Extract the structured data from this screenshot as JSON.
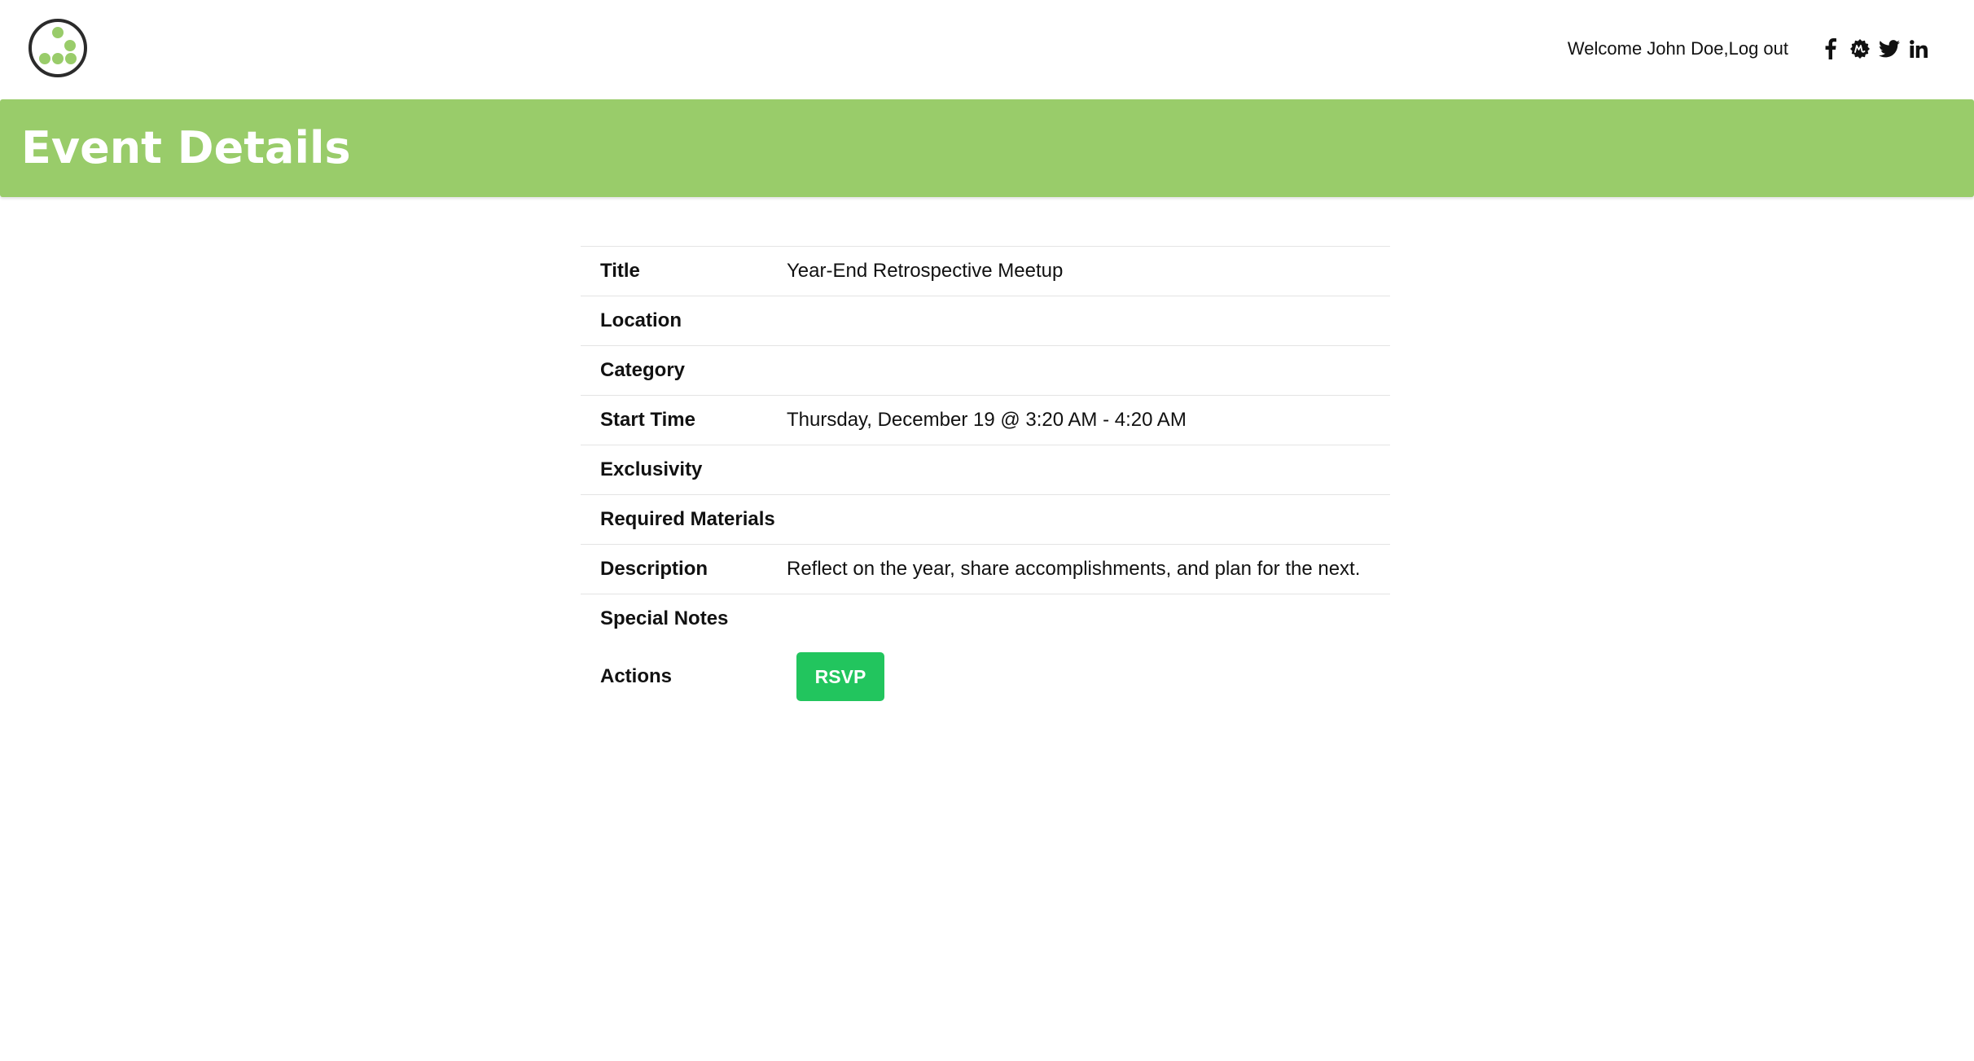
{
  "header": {
    "welcome_text": "Welcome John Doe, ",
    "logout_label": "Log out",
    "social_icons": [
      "facebook-icon",
      "meetup-icon",
      "twitter-icon",
      "linkedin-icon"
    ]
  },
  "page": {
    "title": "Event Details"
  },
  "details": {
    "rows": [
      {
        "label": "Title",
        "value": "Year-End Retrospective Meetup"
      },
      {
        "label": "Location",
        "value": ""
      },
      {
        "label": "Category",
        "value": ""
      },
      {
        "label": "Start Time",
        "value": "Thursday, December 19 @ 3:20 AM - 4:20 AM"
      },
      {
        "label": "Exclusivity",
        "value": ""
      },
      {
        "label": "Required Materials",
        "value": ""
      },
      {
        "label": "Description",
        "value": "Reflect on the year, share accomplishments, and plan for the next."
      },
      {
        "label": "Special Notes",
        "value": ""
      }
    ],
    "actions_label": "Actions",
    "rsvp_label": "RSVP"
  },
  "colors": {
    "header_band": "#99cc6a",
    "logo_dots": "#99cc6a",
    "rsvp_button": "#22c55e"
  }
}
